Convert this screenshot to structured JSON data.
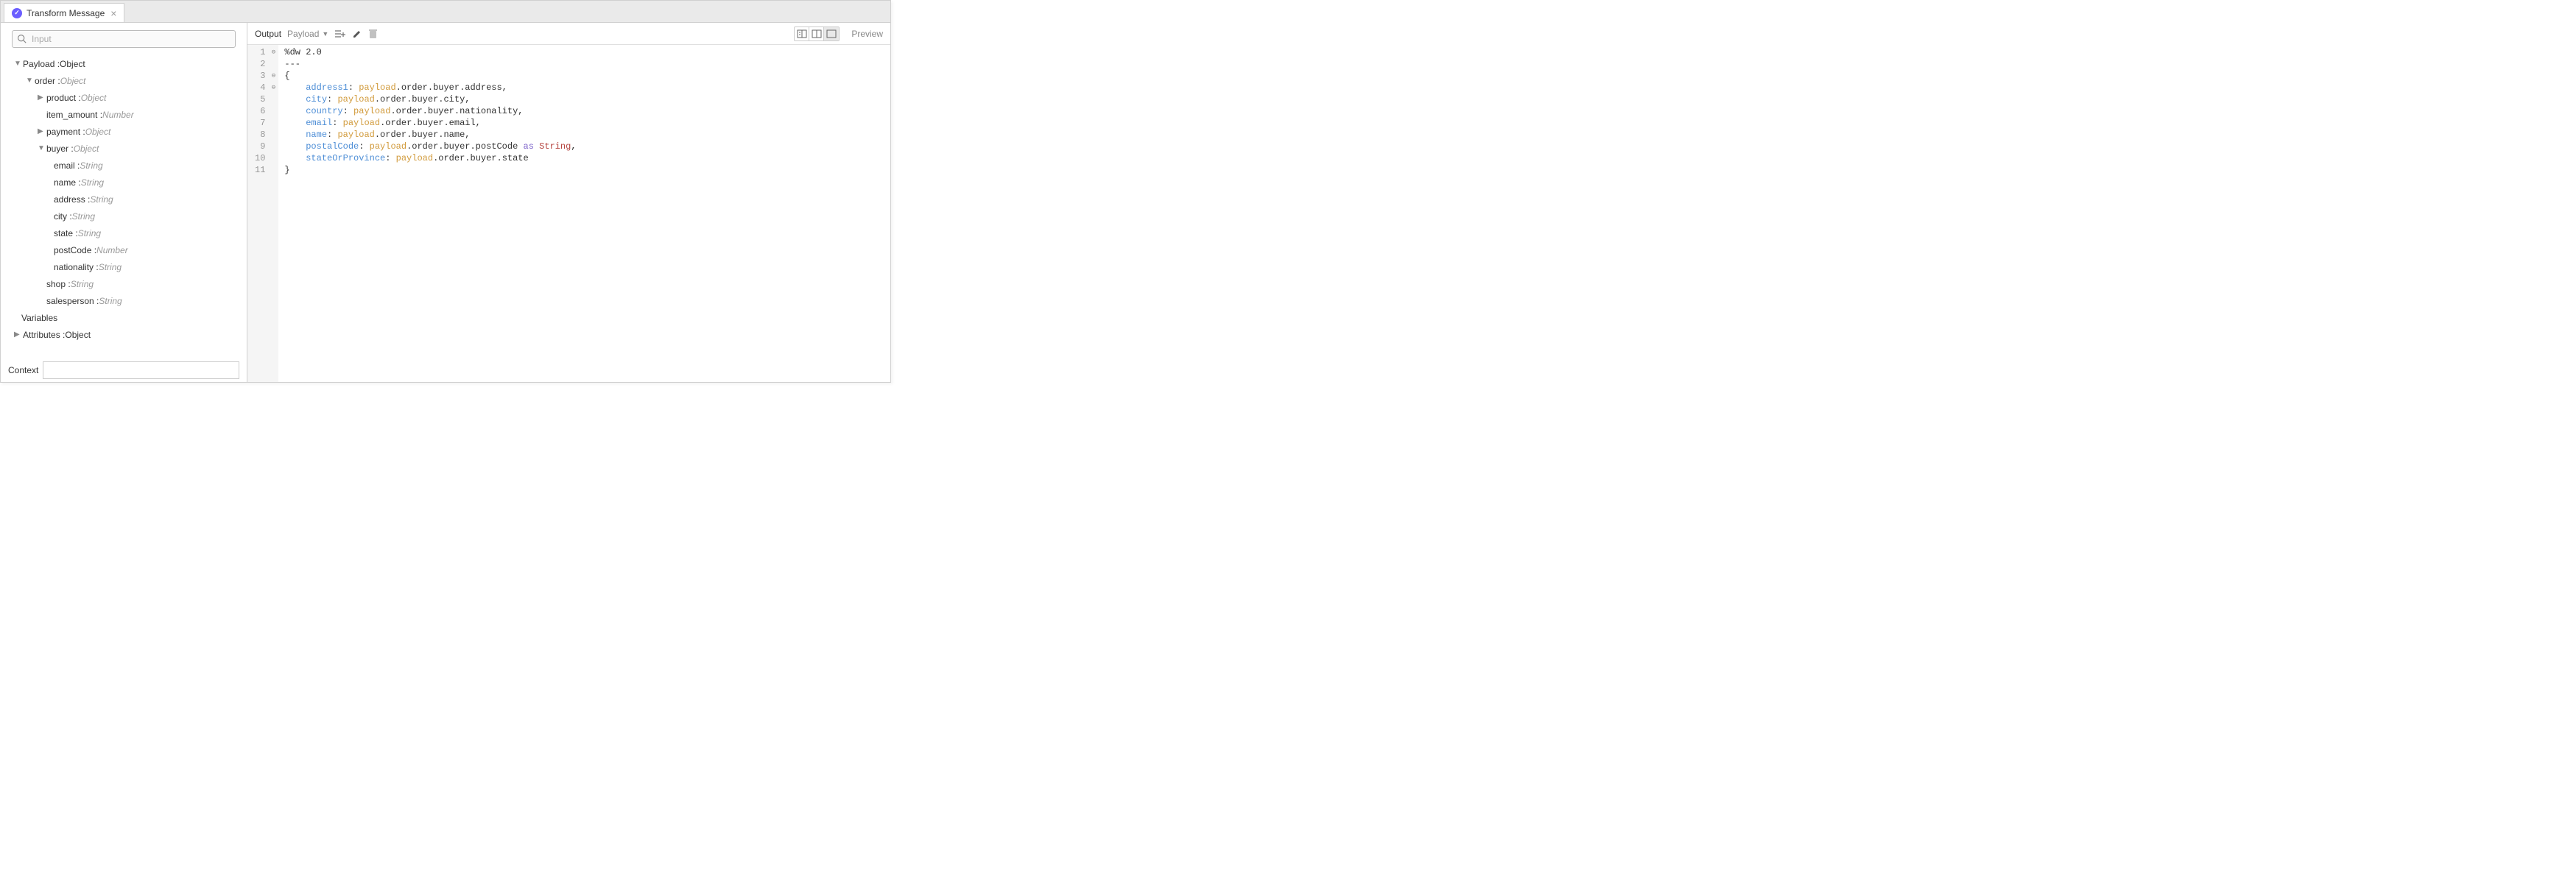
{
  "tab": {
    "title": "Transform Message"
  },
  "left": {
    "search_placeholder": "Input",
    "tree": {
      "payload_label": "Payload : ",
      "payload_type": "Object",
      "order_label": "order : ",
      "order_type": "Object",
      "product_label": "product : ",
      "product_type": "Object",
      "item_amount_label": "item_amount : ",
      "item_amount_type": "Number",
      "payment_label": "payment : ",
      "payment_type": "Object",
      "buyer_label": "buyer : ",
      "buyer_type": "Object",
      "email_label": "email : ",
      "email_type": "String",
      "name_label": "name : ",
      "name_type": "String",
      "address_label": "address : ",
      "address_type": "String",
      "city_label": "city : ",
      "city_type": "String",
      "state_label": "state : ",
      "state_type": "String",
      "postcode_label": "postCode : ",
      "postcode_type": "Number",
      "nationality_label": "nationality : ",
      "nationality_type": "String",
      "shop_label": "shop : ",
      "shop_type": "String",
      "salesperson_label": "salesperson : ",
      "salesperson_type": "String",
      "variables_label": "Variables",
      "attributes_label": "Attributes : ",
      "attributes_type": "Object"
    },
    "context_label": "Context"
  },
  "output": {
    "label": "Output",
    "payload_label": "Payload",
    "preview_label": "Preview"
  },
  "code": {
    "lines": [
      "1",
      "2",
      "3",
      "4",
      "5",
      "6",
      "7",
      "8",
      "9",
      "10",
      "11"
    ],
    "l1_a": "%dw 2.0",
    "l2_a": "---",
    "l3_a": "{",
    "l4_k": "address1",
    "l4_p": "payload",
    "l4_r": ".order.buyer.address,",
    "l5_k": "city",
    "l5_p": "payload",
    "l5_r": ".order.buyer.city,",
    "l6_k": "country",
    "l6_p": "payload",
    "l6_r": ".order.buyer.nationality,",
    "l7_k": "email",
    "l7_p": "payload",
    "l7_r": ".order.buyer.email,",
    "l8_k": "name",
    "l8_p": "payload",
    "l8_r": ".order.buyer.name,",
    "l9_k": "postalCode",
    "l9_p": "payload",
    "l9_m": ".order.buyer.postCode ",
    "l9_op": "as",
    "l9_s": " String",
    "l9_e": ",",
    "l10_k": "stateOrProvince",
    "l10_p": "payload",
    "l10_r": ".order.buyer.state",
    "l11_a": "}"
  }
}
